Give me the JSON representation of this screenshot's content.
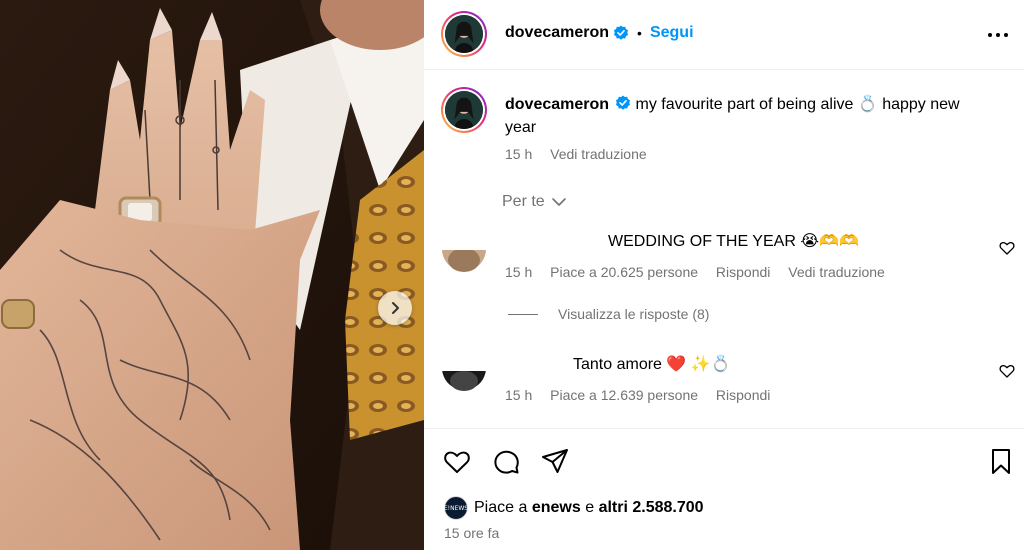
{
  "post": {
    "username": "dovecameron",
    "follow_label": "Segui",
    "dot": "•"
  },
  "caption": {
    "username": "dovecameron",
    "text": "my favourite part of being alive 💍 happy new year",
    "time": "15 h",
    "translate": "Vedi traduzione"
  },
  "for_you": {
    "label": "Per te"
  },
  "comments": [
    {
      "text": "WEDDING OF THE YEAR 😭🫶🫶",
      "time": "15 h",
      "likes": "Piace a 20.625 persone",
      "reply": "Rispondi",
      "translate": "Vedi traduzione"
    },
    {
      "text": "Tanto amore ❤️ ✨💍",
      "time": "15 h",
      "likes": "Piace a 12.639 persone",
      "reply": "Rispondi"
    }
  ],
  "replies": {
    "label": "Visualizza le risposte (8)"
  },
  "likes": {
    "prefix": "Piace a",
    "user": "enews",
    "middle": "e",
    "others": "altri 2.588.700",
    "avatar_text": "E!NEWS"
  },
  "timestamp": "15 ore fa",
  "colors": {
    "accent": "#0095f6",
    "muted": "#737373",
    "verified": "#0095f6"
  },
  "icons": [
    "more-icon",
    "heart-icon",
    "comment-icon",
    "share-icon",
    "bookmark-icon",
    "verified-icon",
    "chevron-down-icon",
    "chevron-right-icon"
  ]
}
